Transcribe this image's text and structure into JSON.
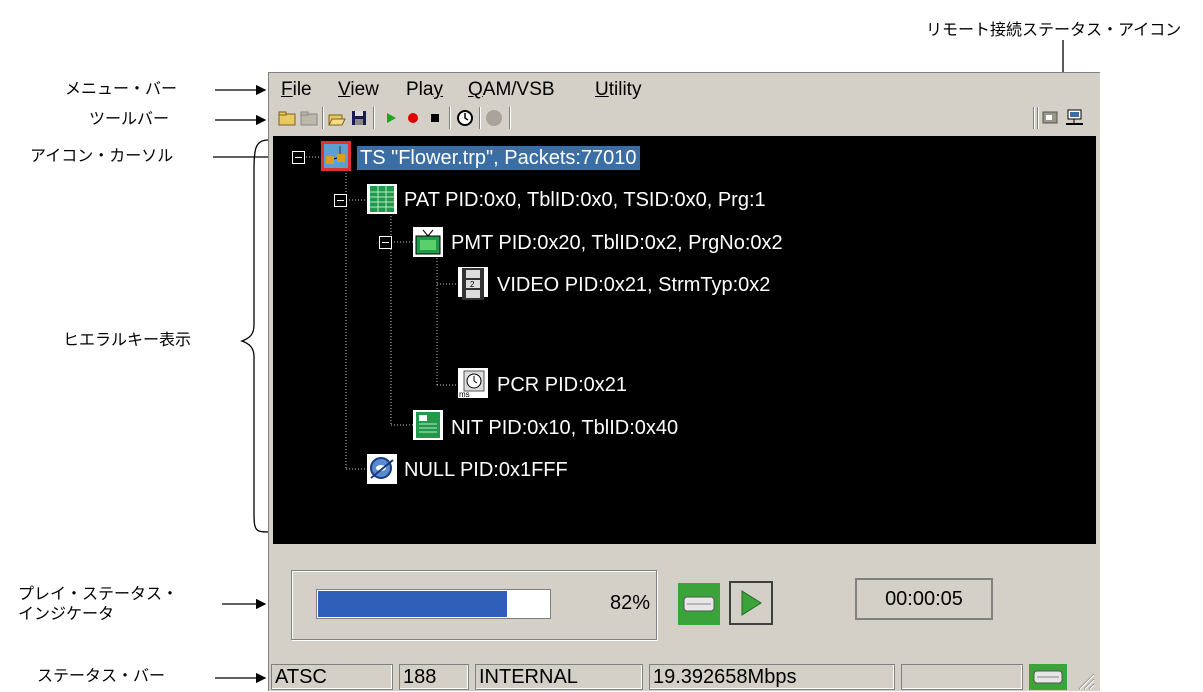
{
  "annotations": {
    "remote_status_icon": "リモート接続ステータス・アイコン",
    "menu_bar": "メニュー・バー",
    "toolbar": "ツールバー",
    "icon_cursor": "アイコン・カーソル",
    "hierarchy_display": "ヒエラルキー表示",
    "play_status_line1": "プレイ・ステータス・",
    "play_status_line2": "インジケータ",
    "status_bar": "ステータス・バー"
  },
  "menu": {
    "file_ul": "F",
    "file_rest": "ile",
    "view_ul": "V",
    "view_rest": "iew",
    "play_pre": "Pla",
    "play_ul": "y",
    "qam_ul": "Q",
    "qam_rest": "AM/VSB",
    "utility_ul": "U",
    "utility_rest": "tility"
  },
  "toolbar_icons": [
    "new-folder-icon",
    "folder-icon",
    "open-icon",
    "save-icon",
    "play-icon",
    "record-icon",
    "stop-icon",
    "clock-icon",
    "circle-icon",
    "remote-status-icon",
    "network-icon"
  ],
  "tree": {
    "ts": "TS \"Flower.trp\", Packets:77010",
    "pat": "PAT PID:0x0, TblID:0x0, TSID:0x0, Prg:1",
    "pmt": "PMT PID:0x20, TblID:0x2, PrgNo:0x2",
    "video": "VIDEO PID:0x21, StrmTyp:0x2",
    "pcr": "PCR PID:0x21",
    "nit": "NIT PID:0x10, TblID:0x40",
    "null": "NULL PID:0x1FFF"
  },
  "play_status": {
    "progress_text": "82%",
    "progress": 0.82,
    "time": "00:00:05"
  },
  "status_bar": {
    "standard": "ATSC",
    "packet_size": "188",
    "clock": "INTERNAL",
    "rate": "19.392658Mbps",
    "empty": ""
  },
  "colors": {
    "tree_bg": "#000000",
    "selection": "#3a6ea5",
    "progress": "#2f5fb8",
    "green": "#3aa33a",
    "window": "#d4d0c8"
  }
}
